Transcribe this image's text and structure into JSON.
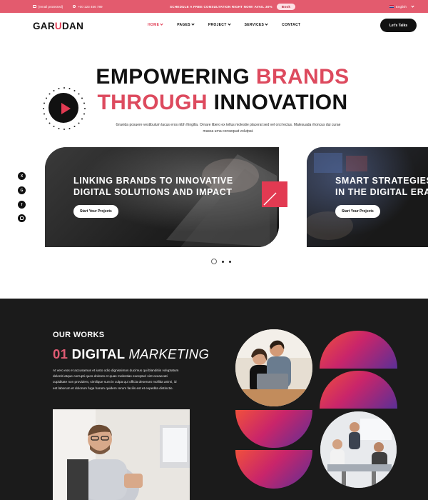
{
  "topbar": {
    "email": "[email protected]",
    "phone": "+00 123 456 789",
    "promo": "SCHEDULE A FREE CONSULTATION RIGHT NOW! AVAIL 30%",
    "book_label": "Book",
    "language": "English"
  },
  "nav": {
    "logo_a": "GAR",
    "logo_b": "U",
    "logo_c": "DAN",
    "items": [
      {
        "label": "HOME",
        "has_caret": true
      },
      {
        "label": "PAGES",
        "has_caret": true
      },
      {
        "label": "PROJECT",
        "has_caret": true
      },
      {
        "label": "SERVICES",
        "has_caret": true
      },
      {
        "label": "CONTACT",
        "has_caret": false
      }
    ],
    "cta_label": "Let's Talks"
  },
  "hero": {
    "line1_a": "EMPOWERING ",
    "line1_b": "BRANDS",
    "line2_a": "THROUGH",
    "line2_b": " INNOVATION",
    "subtitle": "Gravida posuere vestibulum lacus eros nibh fringilla. Ornare libero ex tellus molestie placerat sed vel orci lectus. Malesuada rhoncus dui curae massa urna consequat volutpat.",
    "play_ring_text": "VIDEO • PLAY •"
  },
  "social": [
    "x-icon",
    "google-icon",
    "facebook-icon",
    "instagram-icon"
  ],
  "slides": [
    {
      "title_1": "LINKING BRANDS TO INNOVATIVE",
      "title_2": "DIGITAL SOLUTIONS AND IMPACT",
      "button": "Start Your Projects"
    },
    {
      "title_1": "SMART STRATEGIES",
      "title_2": "IN THE DIGITAL ERA",
      "button": "Start Your Projects"
    }
  ],
  "carousel": {
    "count": 3,
    "active": 1
  },
  "works": {
    "kicker": "OUR WORKS",
    "num": "01",
    "title_bold": " DIGITAL ",
    "title_italic": "MARKETING",
    "text": "At vero eos et accusamus et iusto odio dignissimos ducimus qui blanditiis voluptatum deleniti atque corrupti quos dolores et quas molestias excepturi sint occaecati cupiditate non provident, similique sunt in culpa qui officia deserunt mollitia animi, id est laborum et dolorum fuga harum quidem rerum facilis est et expedita distinctio."
  },
  "colors": {
    "accent": "#dd4a5e",
    "dark": "#1b1b1b",
    "topbar": "#e35b6e"
  }
}
